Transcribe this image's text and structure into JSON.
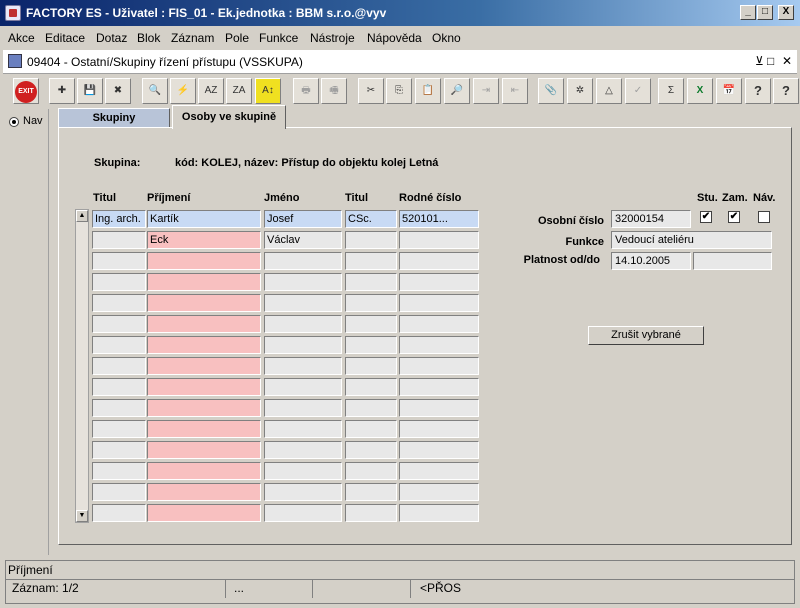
{
  "window": {
    "title": "FACTORY ES - Uživatel : FIS_01 - Ek.jednotka : BBM s.r.o.@vyv",
    "minimize": "_",
    "maximize": "□",
    "close": "X"
  },
  "menu": [
    "Akce",
    "Editace",
    "Dotaz",
    "Blok",
    "Záznam",
    "Pole",
    "Funkce",
    "Nástroje",
    "Nápověda",
    "Okno"
  ],
  "inner_window": {
    "title": "09404 - Ostatní/Skupiny řízení přístupu (VSSKUPA)",
    "controls": [
      "⊻",
      "□",
      "✕"
    ]
  },
  "toolbar": {
    "exit_label": "EXIT",
    "buttons": [
      "add-record",
      "save",
      "delete-record",
      "query",
      "execute-query",
      "sort-asc",
      "sort-desc",
      "sort-custom",
      "print",
      "print-setup",
      "cut",
      "copy",
      "paste",
      "find",
      "indent",
      "outdent",
      "attachment",
      "settings",
      "calc",
      "approve",
      "sum",
      "excel",
      "calendar",
      "help",
      "context-help"
    ],
    "glyphs": [
      "✚",
      "💾",
      "✖",
      "🔍",
      "⚡",
      "AZ",
      "ZA",
      "A↕",
      "🖶",
      "🖷",
      "✂",
      "⎘",
      "📋",
      "🔎",
      "⇥",
      "⇤",
      "📎",
      "✲",
      "△",
      "✓",
      "Σ",
      "X",
      "📅",
      "?",
      "?"
    ]
  },
  "left_nav": {
    "label": "Nav"
  },
  "tabs": {
    "inactive": "Skupiny",
    "active": "Osoby ve skupině"
  },
  "group": {
    "label": "Skupina:",
    "value": "kód: KOLEJ,  název: Přístup do objektu kolej Letná"
  },
  "table": {
    "headers": [
      "Titul",
      "Příjmení",
      "Jméno",
      "Titul",
      "Rodné číslo"
    ],
    "rows": [
      [
        "Ing. arch.",
        "Kartík",
        "Josef",
        "CSc.",
        "520101..."
      ],
      [
        "",
        "Eck",
        "Václav",
        "",
        ""
      ],
      [
        "",
        "",
        "",
        "",
        ""
      ],
      [
        "",
        "",
        "",
        "",
        ""
      ],
      [
        "",
        "",
        "",
        "",
        ""
      ],
      [
        "",
        "",
        "",
        "",
        ""
      ],
      [
        "",
        "",
        "",
        "",
        ""
      ],
      [
        "",
        "",
        "",
        "",
        ""
      ],
      [
        "",
        "",
        "",
        "",
        ""
      ],
      [
        "",
        "",
        "",
        "",
        ""
      ],
      [
        "",
        "",
        "",
        "",
        ""
      ],
      [
        "",
        "",
        "",
        "",
        ""
      ],
      [
        "",
        "",
        "",
        "",
        ""
      ],
      [
        "",
        "",
        "",
        "",
        ""
      ],
      [
        "",
        "",
        "",
        "",
        ""
      ]
    ]
  },
  "flags": {
    "headers": [
      "Stu.",
      "Zam.",
      "Náv."
    ],
    "values": [
      "✔",
      "✔",
      ""
    ]
  },
  "detail": {
    "personal_number_label": "Osobní číslo",
    "personal_number": "32000154",
    "function_label": "Funkce",
    "function_value": "Vedoucí ateliéru",
    "validity_label": "Platnost od/do",
    "valid_from": "14.10.2005",
    "valid_to": ""
  },
  "actions": {
    "cancel_selected": "Zrušit vybrané"
  },
  "status": {
    "message": "Příjmení",
    "record": "Záznam: 1/2",
    "dots": "...",
    "mode": "<PŘOS"
  }
}
